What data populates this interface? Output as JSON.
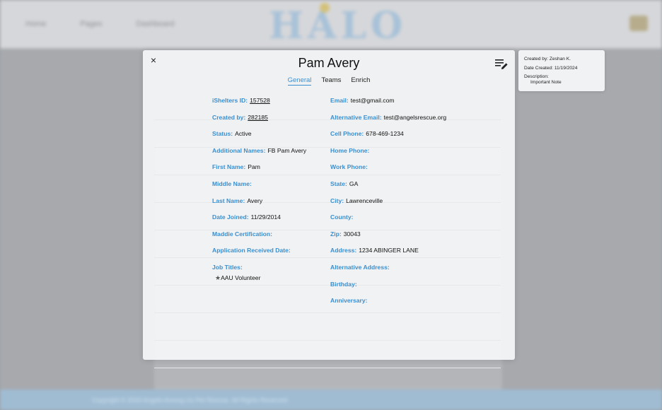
{
  "background": {
    "nav": [
      "Home",
      "Pages",
      "Dashboard"
    ],
    "logo": "HALO",
    "footer_text": "Copyright © 2024 Angels Among Us Pet Rescue. All Rights Reserved."
  },
  "modal": {
    "title": "Pam Avery",
    "close_label": "×",
    "tabs": [
      {
        "label": "General",
        "active": true
      },
      {
        "label": "Teams",
        "active": false
      },
      {
        "label": "Enrich",
        "active": false
      }
    ],
    "left_fields": [
      {
        "label": "iShelters ID:",
        "value": "157528",
        "link": true
      },
      {
        "label": "Created by:",
        "value": "282185",
        "link": true
      },
      {
        "label": "Status:",
        "value": "Active"
      },
      {
        "label": "Additional Names:",
        "value": "FB Pam Avery"
      },
      {
        "label": "First Name:",
        "value": "Pam"
      },
      {
        "label": "Middle Name:",
        "value": ""
      },
      {
        "label": "Last Name:",
        "value": "Avery"
      },
      {
        "label": "Date Joined:",
        "value": "11/29/2014"
      },
      {
        "label": "Maddie Certification:",
        "value": ""
      },
      {
        "label": "Application Received Date:",
        "value": ""
      },
      {
        "label": "Job Titles:",
        "value": ""
      }
    ],
    "job_titles": [
      "AAU Volunteer"
    ],
    "right_fields": [
      {
        "label": "Email:",
        "value": "test@gmail.com"
      },
      {
        "label": "Alternative Email:",
        "value": "test@angelsrescue.org"
      },
      {
        "label": "Cell Phone:",
        "value": "678-469-1234"
      },
      {
        "label": "Home Phone:",
        "value": ""
      },
      {
        "label": "Work Phone:",
        "value": ""
      },
      {
        "label": "State:",
        "value": "GA"
      },
      {
        "label": "City:",
        "value": "Lawrenceville"
      },
      {
        "label": "County:",
        "value": ""
      },
      {
        "label": "Zip:",
        "value": "30043"
      },
      {
        "label": "Address:",
        "value": "1234 ABINGER LANE"
      },
      {
        "label": "Alternative Address:",
        "value": ""
      },
      {
        "label": "Birthday:",
        "value": ""
      },
      {
        "label": "Anniversary:",
        "value": ""
      }
    ]
  },
  "note": {
    "created_by": "Created by: Zeshan K.",
    "date_created": "Date Created: 11/19/2024",
    "description_label": "Description:",
    "description": "Important Note"
  },
  "icons": {
    "close": "close-icon",
    "notes": "notes-edit-icon",
    "star": "star-icon"
  },
  "colors": {
    "label_blue": "#3b8fcf",
    "tab_active": "#3a8fd1"
  }
}
